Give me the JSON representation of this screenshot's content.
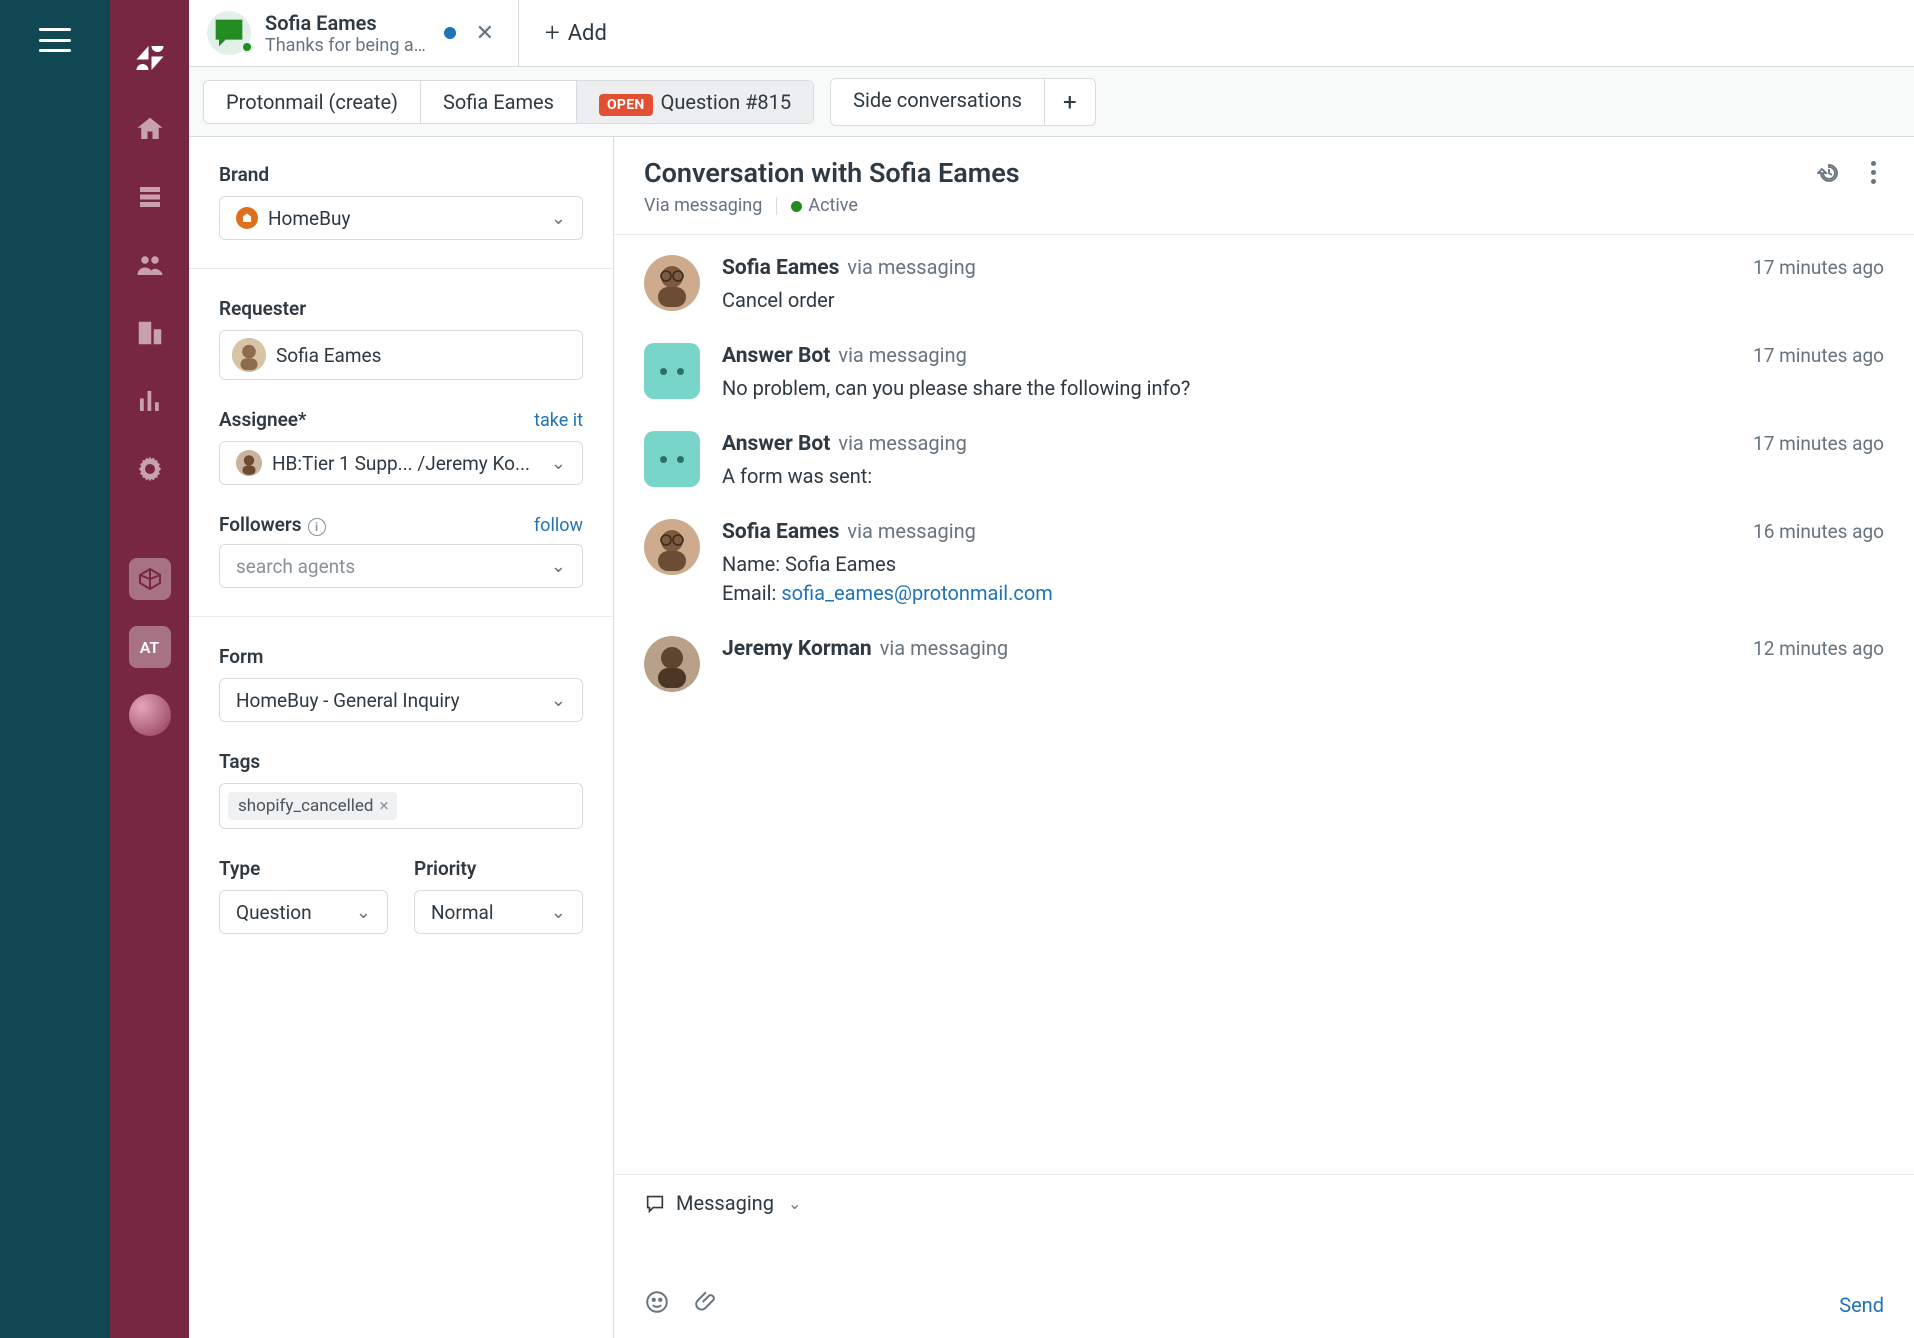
{
  "tabbar": {
    "ticket": {
      "title": "Sofia Eames",
      "subtitle": "Thanks for being a v...",
      "close_label": "✕"
    },
    "add_label": "Add"
  },
  "subnav": {
    "item1": "Protonmail (create)",
    "item2": "Sofia Eames",
    "item3_badge": "OPEN",
    "item3": "Question #815",
    "side_convos": "Side conversations"
  },
  "left": {
    "brand_label": "Brand",
    "brand_value": "HomeBuy",
    "requester_label": "Requester",
    "requester_value": "Sofia Eames",
    "assignee_label": "Assignee*",
    "take_it": "take it",
    "assignee_value": "HB:Tier 1 Supp... /Jeremy Ko...",
    "followers_label": "Followers",
    "follow": "follow",
    "followers_placeholder": "search agents",
    "form_label": "Form",
    "form_value": "HomeBuy - General Inquiry",
    "tags_label": "Tags",
    "tag1": "shopify_cancelled",
    "type_label": "Type",
    "type_value": "Question",
    "priority_label": "Priority",
    "priority_value": "Normal"
  },
  "convo": {
    "title": "Conversation with Sofia Eames",
    "via": "Via messaging",
    "status": "Active"
  },
  "messages": {
    "m0": {
      "name": "Sofia Eames",
      "via": "via messaging",
      "time": "17 minutes ago",
      "text": "Cancel order"
    },
    "m1": {
      "name": "Answer Bot",
      "via": "via messaging",
      "time": "17 minutes ago",
      "text": "No problem, can you please share the following info?"
    },
    "m2": {
      "name": "Answer Bot",
      "via": "via messaging",
      "time": "17 minutes ago",
      "text": "A form was sent:"
    },
    "m3": {
      "name": "Sofia Eames",
      "via": "via messaging",
      "time": "16 minutes ago",
      "line1": "Name: Sofia Eames",
      "line2_prefix": "Email: ",
      "line2_link": "sofia_eames@protonmail.com"
    },
    "m4": {
      "name": "Jeremy Korman",
      "via": "via messaging",
      "time": "12 minutes ago"
    }
  },
  "composer": {
    "channel": "Messaging",
    "send": "Send"
  },
  "rail": {
    "at_label": "AT"
  }
}
